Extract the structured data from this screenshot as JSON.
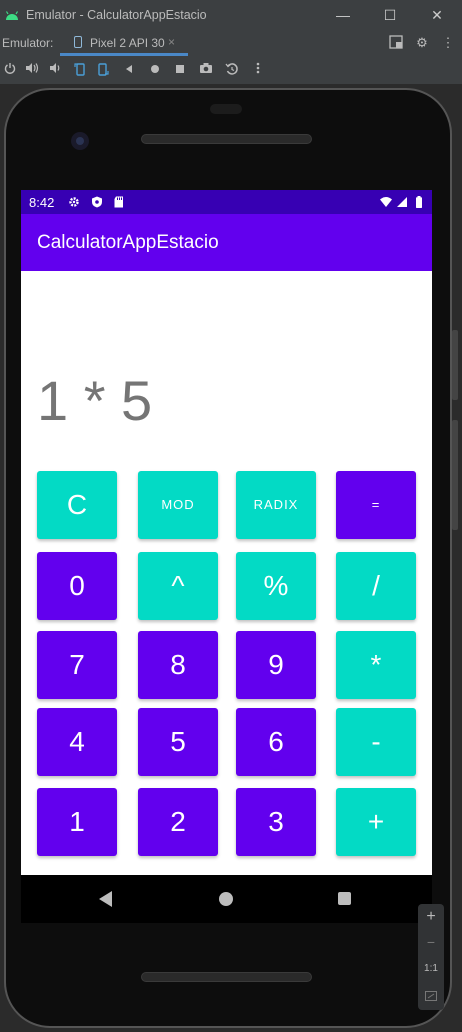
{
  "window": {
    "title": "Emulator - CalculatorAppEstacio",
    "minimize_glyph": "—",
    "maximize_glyph": "☐",
    "close_glyph": "✕"
  },
  "emulator_bar": {
    "label": "Emulator:",
    "tab_label": "Pixel 2 API 30",
    "tab_close": "×",
    "settings_glyph": "⚙",
    "more_glyph": "⋮"
  },
  "toolbar_icons": [
    "power-icon",
    "volume-up-icon",
    "volume-down-icon",
    "rotate-left-icon",
    "rotate-right-icon",
    "back-icon",
    "home-icon",
    "overview-icon",
    "screenshot-icon",
    "snapshot-icon",
    "more-icon"
  ],
  "status_bar": {
    "time": "8:42"
  },
  "app": {
    "title": "CalculatorAppEstacio",
    "display": "1 * 5",
    "buttons": [
      [
        "C",
        "MOD",
        "RADIX",
        "="
      ],
      [
        "0",
        "^",
        "%",
        "/"
      ],
      [
        "7",
        "8",
        "9",
        "*"
      ],
      [
        "4",
        "5",
        "6",
        "-"
      ],
      [
        "1",
        "2",
        "3",
        "+"
      ]
    ]
  },
  "colors": {
    "primary": "#6200ee",
    "primary_dark": "#3700b3",
    "accent": "#03dac5",
    "display_text": "#757575"
  },
  "zoom_panel": {
    "zoom_in": "+",
    "zoom_out": "−",
    "actual_size": "1:1"
  }
}
